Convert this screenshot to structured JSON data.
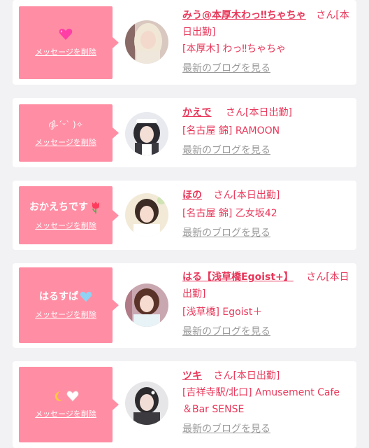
{
  "common": {
    "delete_label": "メッセージを削除",
    "blog_label": "最新のブログを見る"
  },
  "cards": [
    {
      "message": "💗",
      "name": "みう@本厚木わっ‼ちゃちゃ",
      "suffix": "さん[本日出勤]",
      "shop": "[本厚木] わっ‼ちゃちゃ"
    },
    {
      "message": "ദ്ദി˶ˊᵕˋ )✧",
      "name": "かえで",
      "suffix": "さん[本日出勤]",
      "shop": "[名古屋 錦] RAMOON"
    },
    {
      "message": "おかえちです🌷",
      "name": "ほの",
      "suffix": "さん[本日出勤]",
      "shop": "[名古屋 錦] 乙女坂42"
    },
    {
      "message": "はるすぱ🩵",
      "name": "はる【浅草橋Egoist+】",
      "suffix": "さん[本日出勤]",
      "shop": "[浅草橋] Egoist＋"
    },
    {
      "message": "🌙🤍",
      "name": "ツキ",
      "suffix": "さん[本日出勤]",
      "shop": "[吉祥寺駅/北口] Amusement Cafe ＆Bar SENSE"
    }
  ]
}
